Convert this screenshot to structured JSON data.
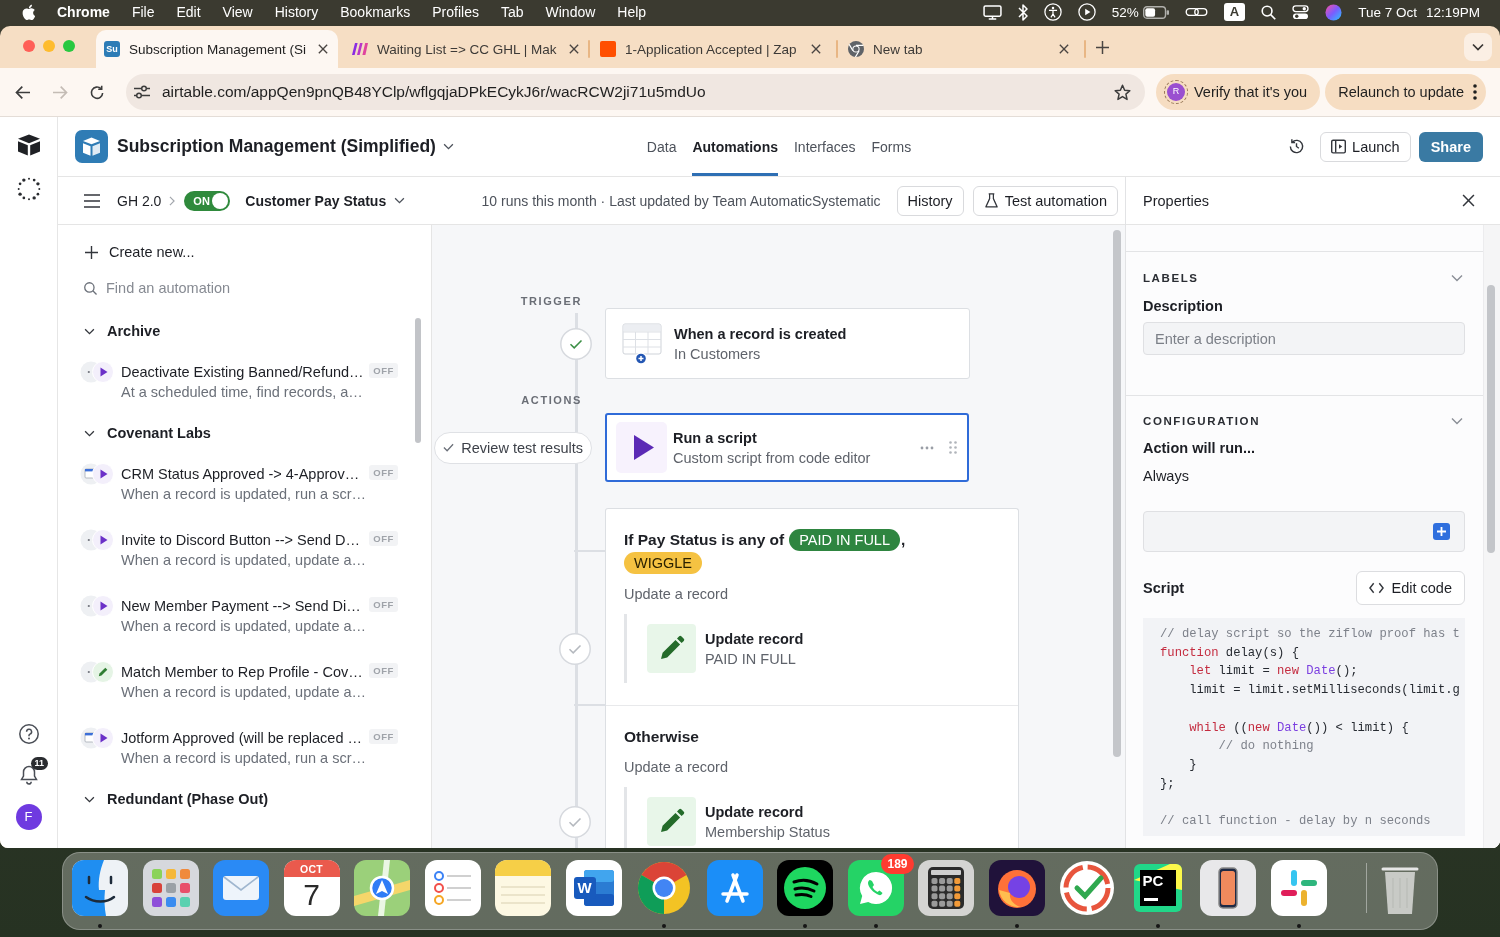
{
  "menu_bar": {
    "app_name": "Chrome",
    "menus": [
      "File",
      "Edit",
      "View",
      "History",
      "Bookmarks",
      "Profiles",
      "Tab",
      "Window",
      "Help"
    ],
    "battery": "52%",
    "input_source": "A",
    "date": "Tue 7 Oct",
    "time": "12:19PM"
  },
  "browser": {
    "tabs": [
      {
        "kind": "airtable",
        "favicon_text": "Su",
        "title": "Subscription Management (Si",
        "selected": true
      },
      {
        "kind": "make",
        "title": "Waiting List => CC GHL | Mak",
        "selected": false
      },
      {
        "kind": "zapier",
        "title": "1-Application Accepted | Zap",
        "selected": false
      },
      {
        "kind": "chrome",
        "title": "New tab",
        "selected": false
      }
    ],
    "nav_buttons": [
      {
        "kind": "back",
        "disabled": false
      },
      {
        "kind": "forward",
        "disabled": true
      },
      {
        "kind": "reload",
        "disabled": false
      }
    ],
    "url": "airtable.com/appQen9pnQB48YClp/wflgqjaDPkECykJ6r/wacRCW2ji71u5mdUo",
    "verify": {
      "initial": "R",
      "label": "Verify that it's you"
    },
    "relaunch_label": "Relaunch to update"
  },
  "app": {
    "base_name": "Subscription Management (Simplified)",
    "nav_tabs": [
      {
        "label": "Data",
        "selected": false
      },
      {
        "label": "Automations",
        "selected": true
      },
      {
        "label": "Interfaces",
        "selected": false
      },
      {
        "label": "Forms",
        "selected": false
      }
    ],
    "launch_label": "Launch",
    "share_label": "Share",
    "notification_count": "11",
    "user_initial": "F"
  },
  "automation_bar": {
    "folder": "GH 2.0",
    "toggle": {
      "label": "ON",
      "on": true
    },
    "name": "Customer Pay Status",
    "status_text": "10 runs this month · Last updated by Team AutomaticSystematic",
    "history_label": "History",
    "test_label": "Test automation"
  },
  "sidebar": {
    "create_label": "Create new...",
    "search_placeholder": "Find an automation",
    "groups": [
      {
        "name": "Archive",
        "expanded": true,
        "items": [
          {
            "title": "Deactivate Existing Banned/Refund…",
            "subtitle": "At a scheduled time, find records, a…",
            "trigger": {
              "kind": "dots"
            },
            "action": {
              "kind": "script"
            },
            "status": "OFF"
          }
        ]
      },
      {
        "name": "Covenant Labs",
        "expanded": true,
        "items": [
          {
            "title": "CRM Status Approved -> 4-Approv…",
            "subtitle": "When a record is updated, run a scr…",
            "trigger": {
              "kind": "window"
            },
            "action": {
              "kind": "script"
            },
            "status": "OFF"
          },
          {
            "title": "Invite to Discord Button --> Send D…",
            "subtitle": "When a record is updated, update a…",
            "trigger": {
              "kind": "dots"
            },
            "action": {
              "kind": "script"
            },
            "status": "OFF"
          },
          {
            "title": "New Member Payment --> Send Di…",
            "subtitle": "When a record is updated, update a…",
            "trigger": {
              "kind": "dots"
            },
            "action": {
              "kind": "script"
            },
            "status": "OFF"
          },
          {
            "title": "Match Member to Rep Profile - Cov…",
            "subtitle": "When a record is updated, update a…",
            "trigger": {
              "kind": "dots"
            },
            "action": {
              "kind": "update"
            },
            "status": "OFF"
          },
          {
            "title": "Jotform Approved (will be replaced …",
            "subtitle": "When a record is updated, run a scr…",
            "trigger": {
              "kind": "window"
            },
            "action": {
              "kind": "script"
            },
            "status": "OFF"
          }
        ]
      },
      {
        "name": "Redundant (Phase Out)",
        "expanded": true
      }
    ]
  },
  "canvas": {
    "trigger_label": "TRIGGER",
    "trigger": {
      "title": "When a record is created",
      "subtitle": "In Customers",
      "passed": true
    },
    "actions_label": "ACTIONS",
    "review_label": "Review test results",
    "script_step": {
      "title": "Run a script",
      "subtitle": "Custom script from code editor",
      "selected": true
    },
    "condition": {
      "text": "If Pay Status is any of",
      "tags": [
        {
          "label": "PAID IN FULL",
          "color": "#2e8540"
        },
        {
          "label": "WIGGLE",
          "color": "#f5c242"
        }
      ],
      "separator": ",",
      "action_label": "Update a record",
      "step": {
        "title": "Update record",
        "subtitle": "PAID IN FULL",
        "passed": false
      }
    },
    "otherwise": {
      "title": "Otherwise",
      "action_label": "Update a record",
      "step": {
        "title": "Update record",
        "subtitle": "Membership Status",
        "passed": false
      }
    }
  },
  "properties": {
    "title": "Properties",
    "labels_section": {
      "heading": "LABELS",
      "expanded": true,
      "field_label": "Description",
      "placeholder": "Enter a description"
    },
    "configuration_section": {
      "heading": "CONFIGURATION",
      "expanded": true,
      "run_label": "Action will run...",
      "run_value": "Always",
      "script_label": "Script",
      "edit_code_label": "Edit code",
      "code_blocks": [
        {
          "lines": [
            [
              {
                "text": "// delay script so the ziflow proof has t",
                "kind": "comment"
              }
            ],
            [
              {
                "text": "function",
                "kind": "keyword"
              },
              {
                "text": " delay(s) {",
                "kind": "plain"
              }
            ],
            [
              {
                "text": "    let",
                "kind": "keyword"
              },
              {
                "text": " limit = ",
                "kind": "plain"
              },
              {
                "text": "new",
                "kind": "keyword"
              },
              {
                "text": " Date",
                "kind": "type"
              },
              {
                "text": "();",
                "kind": "plain"
              }
            ],
            [
              {
                "text": "    limit = limit.setMilliseconds(limit.g",
                "kind": "plain"
              }
            ]
          ]
        },
        {
          "lines": [
            [
              {
                "text": "    while",
                "kind": "keyword"
              },
              {
                "text": " ((",
                "kind": "plain"
              },
              {
                "text": "new",
                "kind": "keyword"
              },
              {
                "text": " Date",
                "kind": "type"
              },
              {
                "text": "()) < limit) {",
                "kind": "plain"
              }
            ],
            [
              {
                "text": "        // do nothing",
                "kind": "comment"
              }
            ],
            [
              {
                "text": "    }",
                "kind": "plain"
              }
            ],
            [
              {
                "text": "};",
                "kind": "plain"
              }
            ]
          ]
        },
        {
          "lines": [
            [
              {
                "text": "// call function - delay by n seconds",
                "kind": "comment"
              }
            ]
          ]
        }
      ]
    }
  },
  "dock": {
    "apps": [
      {
        "kind": "finder",
        "running": true
      },
      {
        "kind": "launchpad",
        "running": false
      },
      {
        "kind": "mail",
        "running": false
      },
      {
        "kind": "calendar",
        "month": "OCT",
        "day": "7",
        "running": false
      },
      {
        "kind": "maps",
        "running": false
      },
      {
        "kind": "reminders",
        "running": false
      },
      {
        "kind": "notes",
        "running": false
      },
      {
        "kind": "word",
        "letter": "W",
        "running": false
      },
      {
        "kind": "chrome",
        "running": true
      },
      {
        "kind": "app_store",
        "running": false
      },
      {
        "kind": "spotify",
        "running": true
      },
      {
        "kind": "whatsapp",
        "badge": "189",
        "running": true
      },
      {
        "kind": "calculator",
        "running": false
      },
      {
        "kind": "firefox",
        "running": true
      },
      {
        "kind": "checkmark",
        "running": false
      },
      {
        "kind": "pycharm",
        "letter": "PC",
        "running": true
      },
      {
        "kind": "iphone",
        "running": false
      },
      {
        "kind": "slack",
        "running": true
      },
      {
        "kind": "trash",
        "running": false
      }
    ]
  }
}
